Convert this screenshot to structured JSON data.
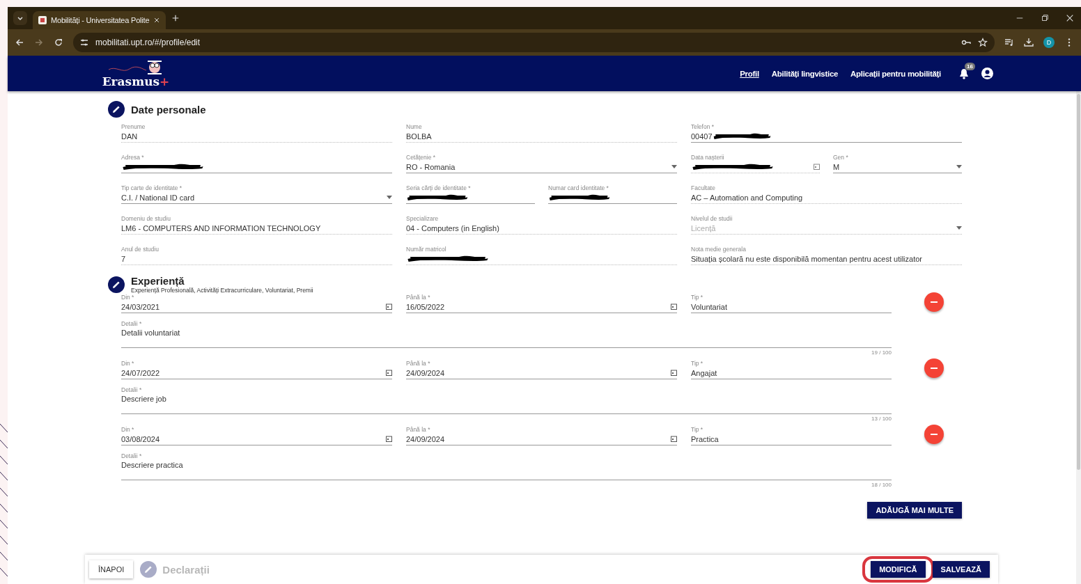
{
  "browser": {
    "tab_title": "Mobilități - Universitatea Polite",
    "url": "mobilitati.upt.ro/#/profile/edit",
    "profile_initial": "D"
  },
  "header": {
    "logo": "Erasmus",
    "logo_plus": "+",
    "nav": [
      {
        "label": "Profil",
        "selected": true
      },
      {
        "label": "Abilități lingvistice",
        "selected": false
      },
      {
        "label": "Aplicații pentru mobilități",
        "selected": false
      }
    ],
    "notifications": "16"
  },
  "personal": {
    "title": "Date personale",
    "rows": [
      [
        [
          {
            "label": "Prenume",
            "value": "DAN",
            "kind": "text",
            "readonly": true
          }
        ],
        [
          {
            "label": "Nume",
            "value": "BOLBA",
            "kind": "text",
            "readonly": true
          }
        ],
        [
          {
            "label": "Telefon *",
            "value": "00407",
            "kind": "text",
            "readonly": false,
            "redacted": true
          }
        ]
      ],
      [
        [
          {
            "label": "Adresa *",
            "kind": "text",
            "readonly": false,
            "redacted": true
          }
        ],
        [
          {
            "label": "Cetățenie *",
            "value": "RO - Romania",
            "kind": "select",
            "readonly": false
          }
        ],
        [
          {
            "label": "Data nașterii",
            "kind": "date",
            "readonly": true,
            "redacted": true
          },
          {
            "label": "Gen *",
            "value": "M",
            "kind": "select",
            "readonly": false
          }
        ]
      ],
      [
        [
          {
            "label": "Tip carte de identitate *",
            "value": "C.I. / National ID card",
            "kind": "select",
            "readonly": false
          }
        ],
        [
          {
            "label": "Seria cărți de identitate *",
            "kind": "text",
            "readonly": false,
            "redacted": true
          },
          {
            "label": "Numar card identitate *",
            "kind": "text",
            "readonly": false,
            "redacted": true
          }
        ],
        [
          {
            "label": "Facultate",
            "value": "AC – Automation and Computing",
            "kind": "text",
            "readonly": true
          }
        ]
      ],
      [
        [
          {
            "label": "Domeniu de studiu",
            "value": "LM6 - COMPUTERS AND INFORMATION TECHNOLOGY",
            "kind": "text",
            "readonly": true
          }
        ],
        [
          {
            "label": "Specializare",
            "value": "04 - Computers (in English)",
            "kind": "text",
            "readonly": true
          }
        ],
        [
          {
            "label": "Nivelul de studii",
            "value": "Licență",
            "kind": "select",
            "readonly": true,
            "disabled": true
          }
        ]
      ],
      [
        [
          {
            "label": "Anul de studiu",
            "value": "7",
            "kind": "text",
            "readonly": true
          }
        ],
        [
          {
            "label": "Număr matricol",
            "kind": "text",
            "readonly": true,
            "redacted": true
          }
        ],
        [
          {
            "label": "Nota medie generala",
            "value": "Situația școlară nu este disponibilă momentan pentru acest utilizator",
            "kind": "text",
            "readonly": true
          }
        ]
      ]
    ]
  },
  "experience": {
    "title": "Experiență",
    "subtitle": "Experiență Profesională, Activități Extracurriculare, Voluntariat, Premii",
    "entries": [
      {
        "from_label": "Din *",
        "from": "24/03/2021",
        "to_label": "Până la *",
        "to": "16/05/2022",
        "type_label": "Tip *",
        "type": "Voluntariat",
        "details_label": "Detalii *",
        "details": "Detalii voluntariat",
        "counter": "19 / 100"
      },
      {
        "from_label": "Din *",
        "from": "24/07/2022",
        "to_label": "Până la *",
        "to": "24/09/2024",
        "type_label": "Tip *",
        "type": "Angajat",
        "details_label": "Detalii *",
        "details": "Descriere job",
        "counter": "13 / 100"
      },
      {
        "from_label": "Din *",
        "from": "03/08/2024",
        "to_label": "Până la *",
        "to": "24/09/2024",
        "type_label": "Tip *",
        "type": "Practica",
        "details_label": "Detalii *",
        "details": "Descriere practica",
        "counter": "18 / 100"
      }
    ],
    "add_button": "ADĂUGĂ MAI MULTE"
  },
  "footer": {
    "back": "ÎNAPOI",
    "next_section": "Declarații",
    "buttons": [
      {
        "label": "MODIFICĂ",
        "highlighted": true
      },
      {
        "label": "SALVEAZĂ",
        "highlighted": false
      }
    ]
  }
}
